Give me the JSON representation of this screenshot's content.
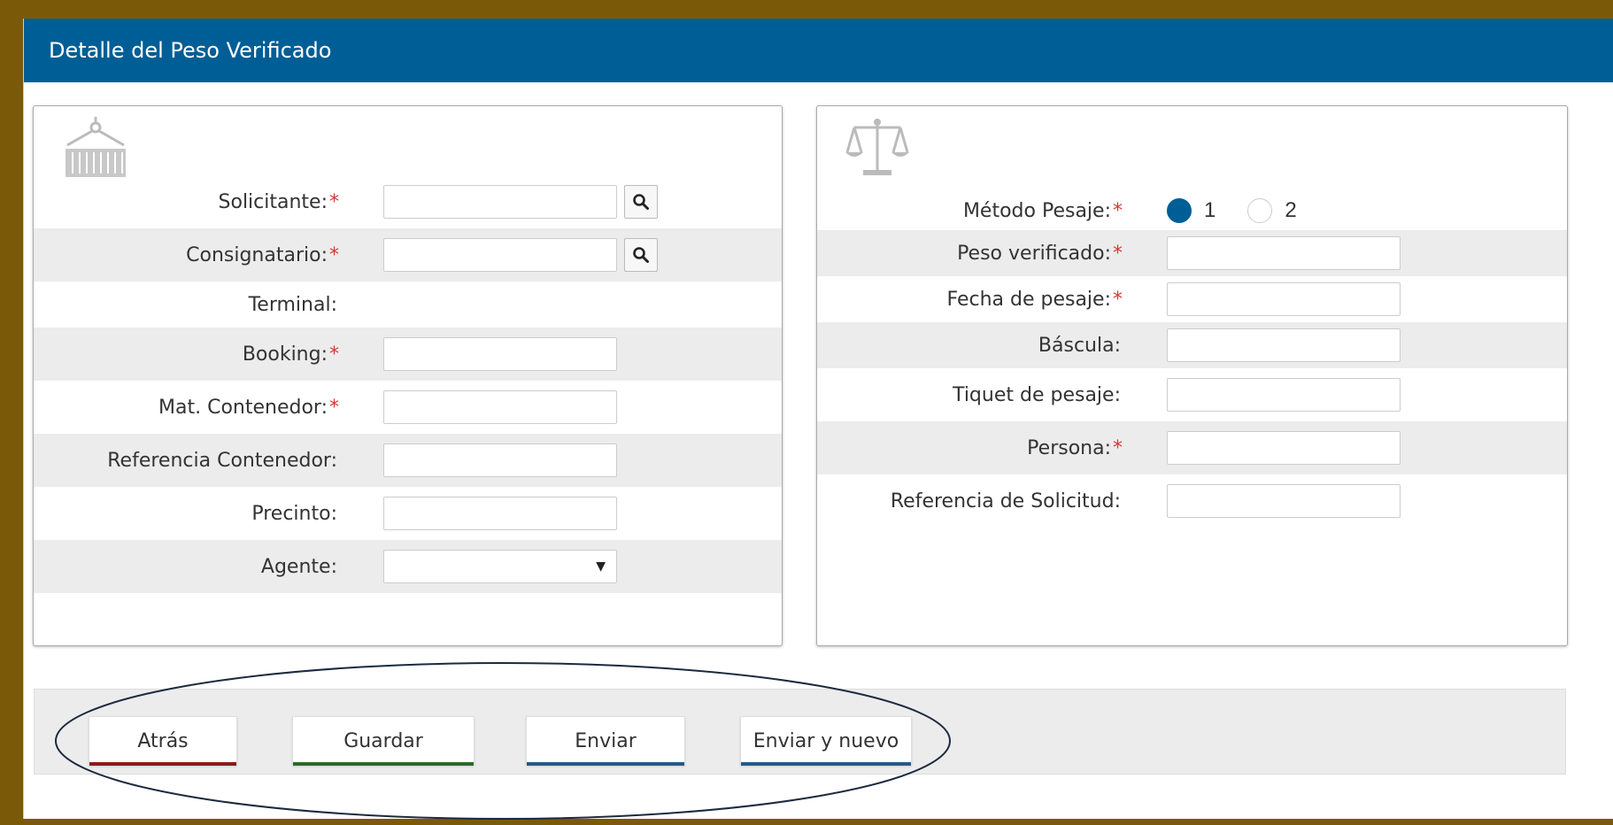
{
  "header": {
    "title": "Detalle del Peso Verificado"
  },
  "left_card": {
    "icon": "container-icon",
    "fields": [
      {
        "label": "Solicitante:",
        "required": "*",
        "value": "",
        "type": "search"
      },
      {
        "label": "Consignatario:",
        "required": "*",
        "value": "",
        "type": "search"
      },
      {
        "label": "Terminal:",
        "required": "",
        "value": "",
        "type": "static"
      },
      {
        "label": "Booking:",
        "required": "*",
        "value": "",
        "type": "text"
      },
      {
        "label": "Mat. Contenedor:",
        "required": "*",
        "value": "",
        "type": "text"
      },
      {
        "label": "Referencia Contenedor:",
        "required": "",
        "value": "",
        "type": "text"
      },
      {
        "label": "Precinto:",
        "required": "",
        "value": "",
        "type": "text"
      },
      {
        "label": "Agente:",
        "required": "",
        "value": "",
        "type": "select"
      }
    ]
  },
  "right_card": {
    "icon": "scale-icon",
    "method": {
      "label": "Método Pesaje:",
      "required": "*",
      "options": [
        {
          "label": "1",
          "checked": true
        },
        {
          "label": "2",
          "checked": false
        }
      ]
    },
    "fields": [
      {
        "label": "Peso verificado:",
        "required": "*",
        "value": ""
      },
      {
        "label": "Fecha de pesaje:",
        "required": "*",
        "value": ""
      },
      {
        "label": "Báscula:",
        "required": "",
        "value": ""
      },
      {
        "label": "Tiquet de pesaje:",
        "required": "",
        "value": ""
      },
      {
        "label": "Persona:",
        "required": "*",
        "value": ""
      },
      {
        "label": "Referencia de Solicitud:",
        "required": "",
        "value": ""
      }
    ]
  },
  "buttons": {
    "back": "Atrás",
    "save": "Guardar",
    "send": "Enviar",
    "send_new": "Enviar y nuevo"
  },
  "colors": {
    "header": "#005e96",
    "frame": "#7a5a08",
    "required": "#dd3333",
    "back_accent": "#8b1a1a",
    "save_accent": "#2b6a2b",
    "send_accent": "#245a8c"
  }
}
